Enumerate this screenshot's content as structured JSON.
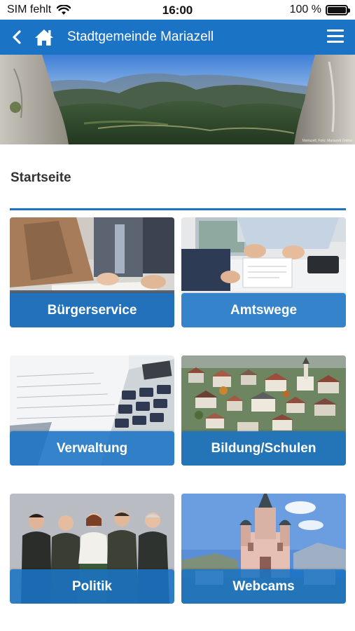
{
  "status_bar": {
    "carrier": "SIM fehlt",
    "time": "16:00",
    "battery_percent": "100 %",
    "battery_level": 1.0
  },
  "nav": {
    "title": "Stadtgemeinde Mariazell"
  },
  "banner": {
    "credit": "Mariazell, Foto: Mariazell Online"
  },
  "page": {
    "heading": "Startseite"
  },
  "colors": {
    "primary": "#1a73c4"
  },
  "tiles": [
    {
      "label": "Bürgerservice"
    },
    {
      "label": "Amtswege"
    },
    {
      "label": "Verwaltung"
    },
    {
      "label": "Bildung/Schulen"
    },
    {
      "label": "Politik"
    },
    {
      "label": "Webcams"
    }
  ]
}
